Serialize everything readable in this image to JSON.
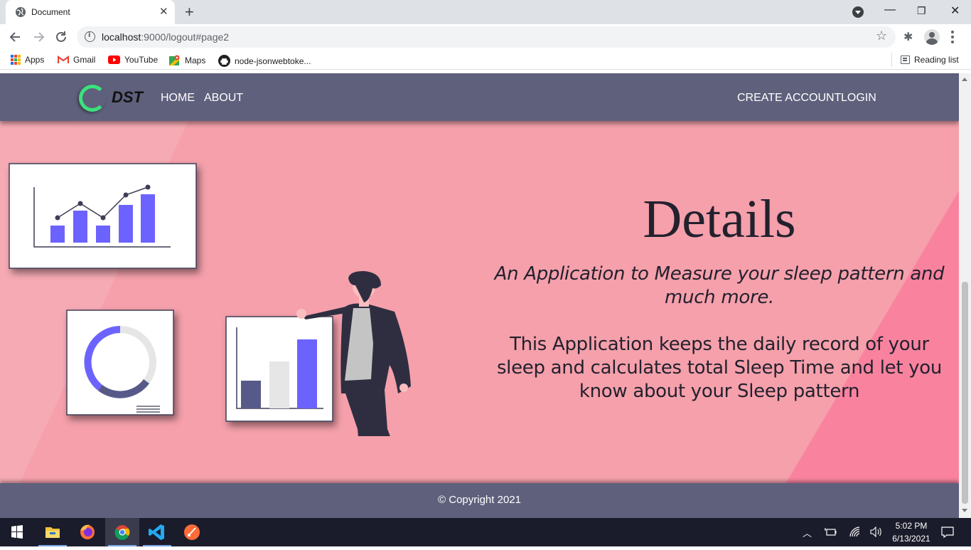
{
  "browser": {
    "tab_title": "Document",
    "url_host": "localhost",
    "url_rest": ":9000/logout#page2",
    "bookmarks": [
      "Apps",
      "Gmail",
      "YouTube",
      "Maps",
      "node-jsonwebtoke..."
    ],
    "reading_list": "Reading list"
  },
  "site": {
    "logo_text": "DST",
    "nav_left": [
      "HOME",
      "ABOUT"
    ],
    "nav_right": [
      "CREATE ACCOUNT",
      "LOGIN"
    ],
    "title": "Details",
    "tagline": "An Application to Measure your sleep pattern and much more.",
    "description": "This Application keeps the daily record of your sleep and calculates total Sleep Time and let you know about your Sleep pattern",
    "footer": "© Copyright 2021"
  },
  "taskbar": {
    "time": "5:02 PM",
    "date": "6/13/2021"
  },
  "colors": {
    "nav_bg": "#5f607c",
    "page_bg": "#f5a0ab",
    "accent": "#6c63ff",
    "logo_ring": "#3be27b"
  }
}
